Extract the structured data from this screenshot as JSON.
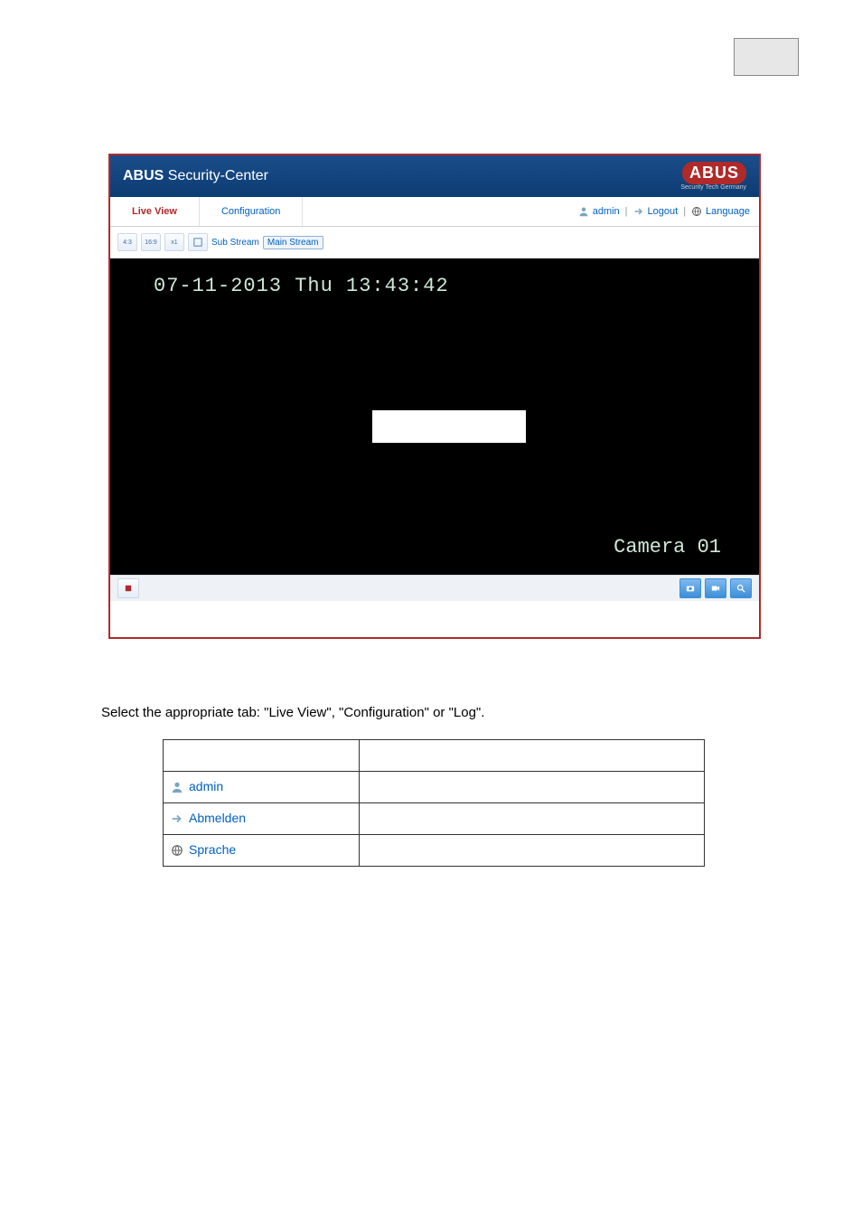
{
  "header": {
    "brand_bold": "ABUS",
    "brand_rest": " Security-Center",
    "logo_text": "ABUS",
    "logo_sub": "Security Tech Germany"
  },
  "navbar": {
    "tabs": [
      "Live View",
      "Configuration"
    ],
    "user_label": "admin",
    "logout_label": "Logout",
    "language_label": "Language"
  },
  "toolbar": {
    "sub_stream": "Sub Stream",
    "main_stream": "Main Stream"
  },
  "video": {
    "timestamp": "07-11-2013 Thu 13:43:42",
    "camera_label": "Camera 01"
  },
  "body_text": "Select the appropriate tab: \"Live View\", \"Configuration\" or \"Log\".",
  "mini_rows": {
    "r1": "admin",
    "r2": "Abmelden",
    "r3": "Sprache"
  }
}
